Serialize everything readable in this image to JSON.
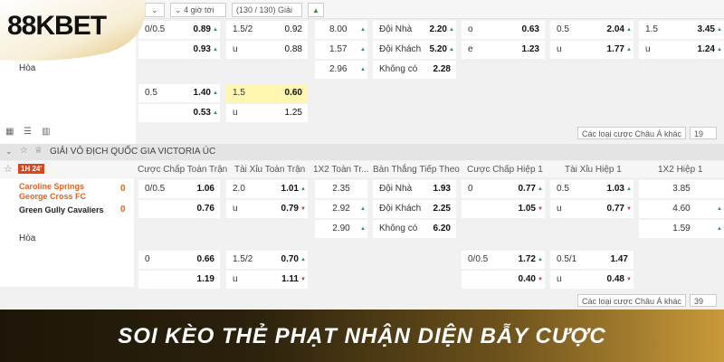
{
  "brand": {
    "logo_text": "88KBET",
    "banner_text": "SOI KÈO THẺ PHẠT NHẬN DIỆN BẪY CƯỢC"
  },
  "filter": {
    "time": "4 giờ tới",
    "count": "(130 / 130) Giải"
  },
  "select_odds": "Các loại cược Châu Á khác",
  "select_count": "19",
  "select_count2": "39",
  "match1": {
    "draw": "Hòa"
  },
  "league": {
    "name": "GIẢI VÔ ĐỊCH QUỐC GIA VICTORIA ÚC"
  },
  "columns": [
    "Cược Chấp Toàn Trận",
    "Tài Xỉu Toàn Trận",
    "1X2 Toàn Tr...",
    "Bàn Thắng Tiếp Theo",
    "Cược Chấp Hiệp 1",
    "Tài Xỉu Hiệp 1",
    "1X2 Hiệp 1"
  ],
  "match2": {
    "time_badge": "1H 24'",
    "home": "Caroline Springs George Cross FC",
    "away": "Green Gully Cavaliers",
    "home_score": "0",
    "away_score": "0",
    "draw": "Hòa"
  },
  "colors": {
    "up": "#2a9b3b",
    "down": "#d0342c",
    "accent": "#e2621f",
    "banner_gold": "#d9b25a"
  }
}
